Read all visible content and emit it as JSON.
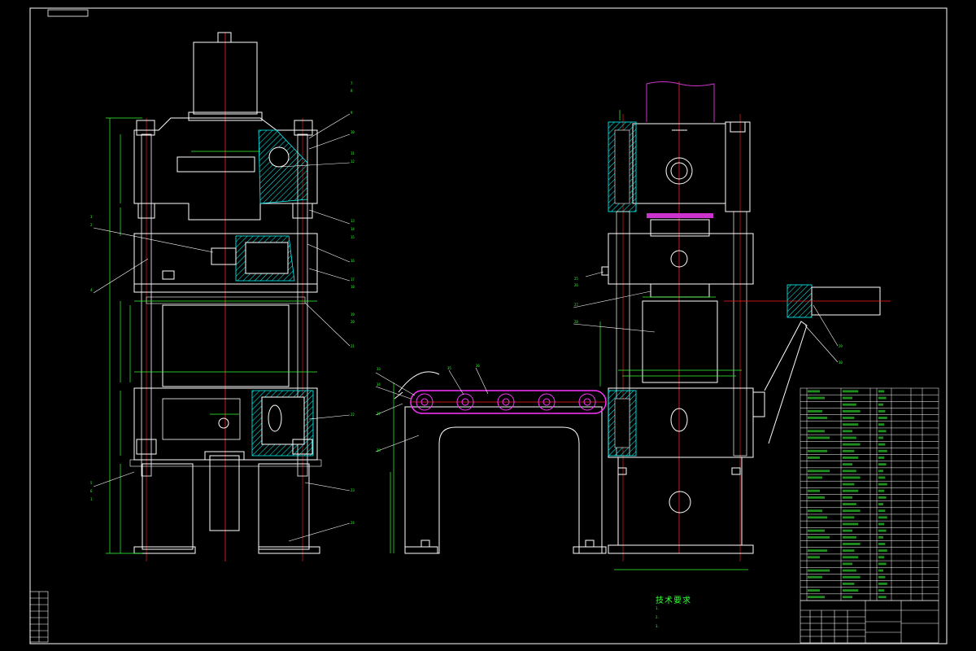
{
  "drawing": {
    "technical_requirements_title": "技术要求",
    "technical_requirements": [
      "1.",
      "2.",
      "3."
    ],
    "colors": {
      "outline": "#ffffff",
      "hatch": "#00ffff",
      "centerline": "#ff2222",
      "dimension": "#33ff33",
      "chain": "#ff33ff",
      "motor": "#cc33cc",
      "leader": "#ffffff",
      "table": "#ffffff"
    }
  }
}
